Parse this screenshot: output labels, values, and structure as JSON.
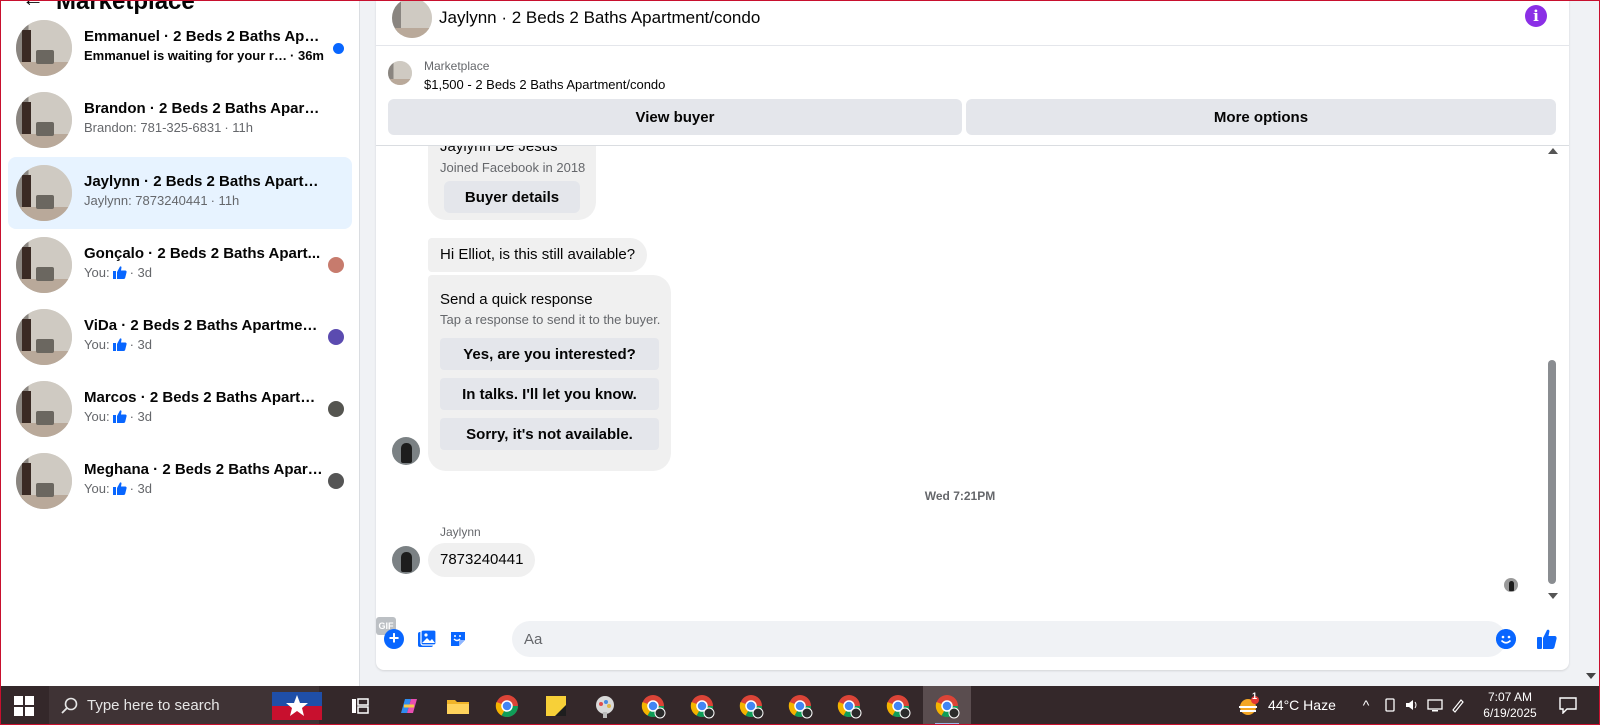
{
  "sidebar": {
    "title": "Marketplace",
    "conversations": [
      {
        "name": "Emmanuel · 2 Beds 2 Baths Apar...",
        "preview": "Emmanuel is waiting for your res...",
        "time": "· 36m",
        "unread": true
      },
      {
        "name": "Brandon · 2 Beds 2 Baths Apartme...",
        "preview": "Brandon: 781-325-6831",
        "time": "· 11h"
      },
      {
        "name": "Jaylynn · 2 Beds 2 Baths Apartmen...",
        "preview": "Jaylynn: 7873240441",
        "time": "· 11h",
        "active": true
      },
      {
        "name": "Gonçalo · 2 Beds 2 Baths Apart...",
        "preview": "You:",
        "time": "· 3d"
      },
      {
        "name": "ViDa · 2 Beds 2 Baths Apartmen...",
        "preview": "You:",
        "time": "· 3d"
      },
      {
        "name": "Marcos · 2 Beds 2 Baths Apartm...",
        "preview": "You:",
        "time": "· 3d"
      },
      {
        "name": "Meghana · 2 Beds 2 Baths Apartm...",
        "preview": "You:",
        "time": "· 3d"
      }
    ],
    "accent": "#0866ff",
    "active_bg": "#e7f3ff"
  },
  "chat": {
    "title": "Jaylynn · 2 Beds 2 Baths Apartment/condo",
    "marketplace_label": "Marketplace",
    "listing": "$1,500 - 2 Beds 2 Baths Apartment/condo",
    "view_buyer": "View buyer",
    "more_options": "More options",
    "buyer_card": {
      "name": "Jaylynn De Jesus",
      "joined": "Joined Facebook in 2018",
      "button": "Buyer details"
    },
    "first_message": "Hi Elliot, is this still available?",
    "quick_response": {
      "title": "Send a quick response",
      "subtitle": "Tap a response to send it to the buyer.",
      "options": [
        "Yes, are you interested?",
        "In talks. I'll let you know.",
        "Sorry, it's not available."
      ]
    },
    "timestamp": "Wed 7:21PM",
    "sender": "Jaylynn",
    "phone_message": "7873240441",
    "composer_placeholder": "Aa",
    "gif_label": "GIF",
    "info_glyph": "i",
    "plus_glyph": "+"
  },
  "taskbar": {
    "search_placeholder": "Type here to search",
    "weather": "44°C  Haze",
    "time": "7:07 AM",
    "date": "6/19/2025",
    "weather_badge": "1"
  }
}
